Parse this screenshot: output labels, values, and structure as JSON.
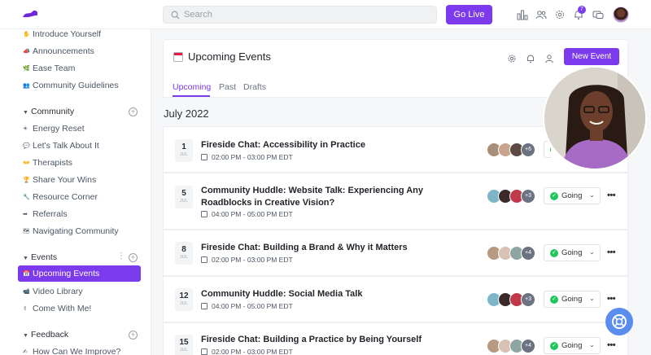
{
  "topbar": {
    "search_placeholder": "Search",
    "go_live_label": "Go Live",
    "notification_count": "7",
    "icons": [
      "leaderboard-icon",
      "members-icon",
      "settings-icon",
      "bell-icon",
      "messages-icon"
    ]
  },
  "sidebar": {
    "top_items": [
      {
        "label": "Introduce Yourself",
        "icon": "wave-icon"
      },
      {
        "label": "Announcements",
        "icon": "megaphone-icon"
      },
      {
        "label": "Ease Team",
        "icon": "team-icon"
      },
      {
        "label": "Community Guidelines",
        "icon": "guidelines-icon"
      }
    ],
    "community": {
      "title": "Community",
      "items": [
        {
          "label": "Energy Reset",
          "icon": "sun-icon"
        },
        {
          "label": "Let's Talk About It",
          "icon": "chat-icon"
        },
        {
          "label": "Therapists",
          "icon": "therapist-icon"
        },
        {
          "label": "Share Your Wins",
          "icon": "trophy-icon"
        },
        {
          "label": "Resource Corner",
          "icon": "wrench-icon"
        },
        {
          "label": "Referrals",
          "icon": "referral-icon"
        },
        {
          "label": "Navigating Community",
          "icon": "map-icon"
        }
      ]
    },
    "events": {
      "title": "Events",
      "items": [
        {
          "label": "Upcoming Events",
          "icon": "calendar-icon",
          "active": true
        },
        {
          "label": "Video Library",
          "icon": "video-icon"
        },
        {
          "label": "Come With Me!",
          "icon": "hand-icon"
        }
      ]
    },
    "feedback": {
      "title": "Feedback",
      "items": [
        {
          "label": "How Can We Improve?",
          "icon": "pencil-icon"
        }
      ]
    }
  },
  "header": {
    "title": "Upcoming Events",
    "new_event_label": "New Event",
    "tabs": [
      "Upcoming",
      "Past",
      "Drafts"
    ]
  },
  "month_label": "July 2022",
  "events": [
    {
      "day": "1",
      "month": "JUL",
      "title": "Fireside Chat: Accessibility in Practice",
      "time": "02:00 PM - 03:00 PM EDT",
      "more_count": "+6",
      "rsvp": "Going"
    },
    {
      "day": "5",
      "month": "JUL",
      "title": "Community Huddle: Website Talk: Experiencing Any Roadblocks in Creative Vision?",
      "time": "04:00 PM - 05:00 PM EDT",
      "more_count": "+3",
      "rsvp": "Going"
    },
    {
      "day": "8",
      "month": "JUL",
      "title": "Fireside Chat: Building a Brand & Why it Matters",
      "time": "02:00 PM - 03:00 PM EDT",
      "more_count": "+4",
      "rsvp": "Going"
    },
    {
      "day": "12",
      "month": "JUL",
      "title": "Community Huddle: Social Media Talk",
      "time": "04:00 PM - 05:00 PM EDT",
      "more_count": "+3",
      "rsvp": "Going"
    },
    {
      "day": "15",
      "month": "JUL",
      "title": "Fireside Chat: Building a Practice by Being Yourself",
      "time": "02:00 PM - 03:00 PM EDT",
      "more_count": "+4",
      "rsvp": "Going"
    }
  ],
  "colors": {
    "accent": "#7c3aed",
    "going_check": "#22c55e",
    "help_fab": "#5b8def"
  }
}
